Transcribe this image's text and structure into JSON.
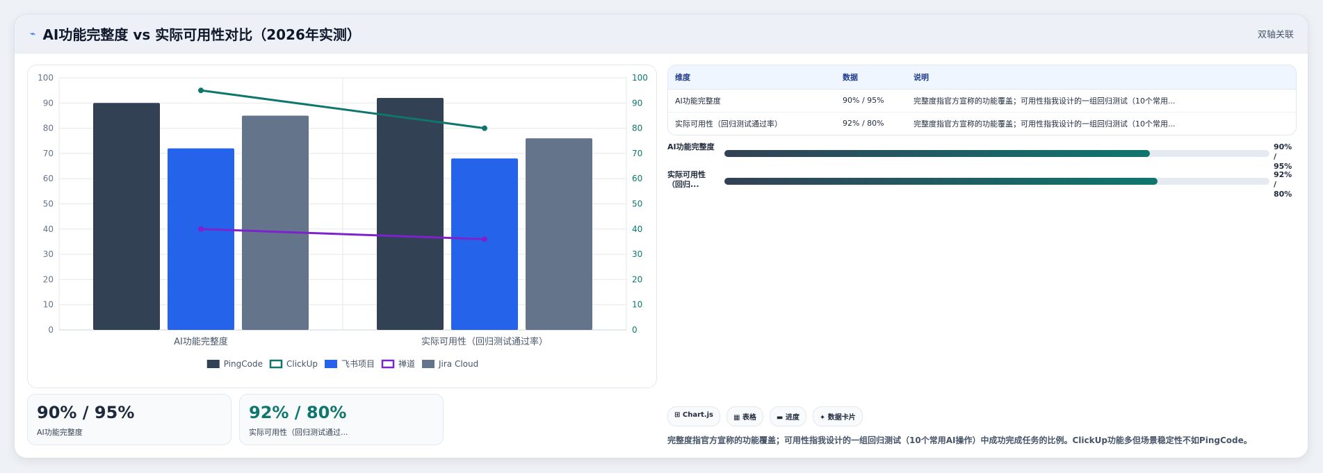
{
  "header": {
    "title": "AI功能完整度 vs 实际可用性对比（2026年实测）",
    "badge": "双轴关联"
  },
  "colors": {
    "pingcode": "#334155",
    "clickup": "#0f766e",
    "feishu": "#2563eb",
    "chandao": "#7e22ce",
    "jira": "#64748b"
  },
  "chart_data": {
    "type": "bar",
    "categories": [
      "AI功能完整度",
      "实际可用性（回归测试通过率）"
    ],
    "series": [
      {
        "name": "PingCode",
        "type": "bar",
        "values": [
          90,
          92
        ],
        "color": "#334155"
      },
      {
        "name": "ClickUp",
        "type": "line",
        "axis": "right",
        "values": [
          95,
          80
        ],
        "color": "#0f766e"
      },
      {
        "name": "飞书项目",
        "type": "bar",
        "values": [
          72,
          68
        ],
        "color": "#2563eb"
      },
      {
        "name": "禅道",
        "type": "line",
        "axis": "left",
        "values": [
          40,
          36
        ],
        "color": "#7e22ce"
      },
      {
        "name": "Jira Cloud",
        "type": "bar",
        "values": [
          85,
          76
        ],
        "color": "#64748b"
      }
    ],
    "ylim": [
      0,
      100
    ],
    "y2lim": [
      0,
      100
    ],
    "yticks": [
      "0",
      "10",
      "20",
      "30",
      "40",
      "50",
      "60",
      "70",
      "80",
      "90",
      "100"
    ],
    "grid": true,
    "legend": "bottom"
  },
  "stats": [
    {
      "value": "90% / 95%",
      "label": "AI功能完整度",
      "color": "#1e293b"
    },
    {
      "value": "92% / 80%",
      "label": "实际可用性（回归测试通过...",
      "color": "#0f766e"
    }
  ],
  "table": {
    "headers": [
      "维度",
      "数据",
      "说明"
    ],
    "rows": [
      [
        "AI功能完整度",
        "90% / 95%",
        "完整度指官方宣称的功能覆盖；可用性指我设计的一组回归测试（10个常用..."
      ],
      [
        "实际可用性（回归测试通过率）",
        "92% / 80%",
        "完整度指官方宣称的功能覆盖；可用性指我设计的一组回归测试（10个常用..."
      ]
    ]
  },
  "progress": [
    {
      "label": "AI功能完整度",
      "value_text": "90% / 95%",
      "fraction": 0.78
    },
    {
      "label": "实际可用性（回归...",
      "value_text": "92% / 80%",
      "fraction": 0.795
    }
  ],
  "chips": [
    "⊞ Chart.js",
    "▦ 表格",
    "▬ 进度",
    "✦ 数据卡片"
  ],
  "note": "完整度指官方宣称的功能覆盖；可用性指我设计的一组回归测试（10个常用AI操作）中成功完成任务的比例。ClickUp功能多但场景稳定性不如PingCode。"
}
